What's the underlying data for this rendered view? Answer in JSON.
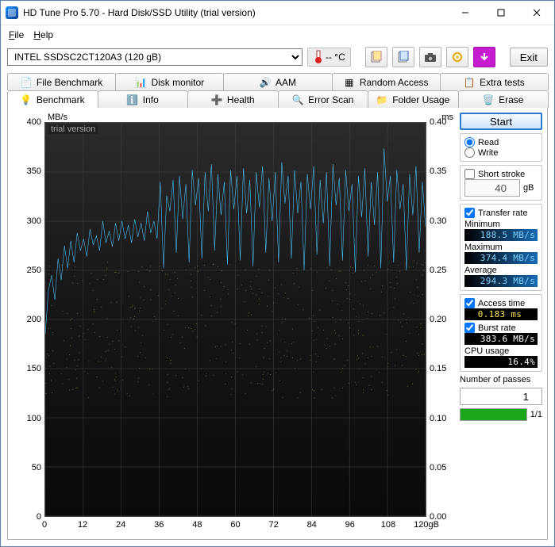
{
  "window": {
    "title": "HD Tune Pro 5.70 - Hard Disk/SSD Utility (trial version)"
  },
  "menu": {
    "file": "File",
    "help": "Help"
  },
  "drive": {
    "selected": "INTEL SSDSC2CT120A3 (120 gB)"
  },
  "temp": "-- °C",
  "exit": "Exit",
  "tabs": {
    "row1": [
      "File Benchmark",
      "Disk monitor",
      "AAM",
      "Random Access",
      "Extra tests"
    ],
    "row2": [
      "Benchmark",
      "Info",
      "Health",
      "Error Scan",
      "Folder Usage",
      "Erase"
    ],
    "active": "Benchmark"
  },
  "side": {
    "start": "Start",
    "read": "Read",
    "write": "Write",
    "short_stroke": "Short stroke",
    "short_stroke_val": "40",
    "short_stroke_unit": "gB",
    "transfer_rate": "Transfer rate",
    "minimum": "Minimum",
    "min_val": "188.5 MB/s",
    "maximum": "Maximum",
    "max_val": "374.4 MB/s",
    "average": "Average",
    "avg_val": "294.3 MB/s",
    "access_time": "Access time",
    "access_val": "0.183 ms",
    "burst_rate": "Burst rate",
    "burst_val": "383.6 MB/s",
    "cpu_usage": "CPU usage",
    "cpu_val": "16.4%",
    "passes": "Number of passes",
    "passes_val": "1",
    "progress_label": "1/1"
  },
  "chart_data": {
    "type": "line+scatter",
    "title": "",
    "watermark": "trial version",
    "x_unit": "gB",
    "y1_label": "MB/s",
    "y2_label": "ms",
    "y1_range": [
      0,
      400
    ],
    "y2_range": [
      0,
      0.4
    ],
    "x_range": [
      0,
      120
    ],
    "x_ticks": [
      0,
      12,
      24,
      36,
      48,
      60,
      72,
      84,
      96,
      108,
      120
    ],
    "y1_ticks": [
      0,
      50,
      100,
      150,
      200,
      250,
      300,
      350,
      400
    ],
    "y2_ticks": [
      0.0,
      0.05,
      0.1,
      0.15,
      0.2,
      0.25,
      0.3,
      0.35,
      0.4
    ],
    "transfer_series_mb_s": [
      185,
      230,
      245,
      220,
      262,
      240,
      275,
      252,
      280,
      258,
      288,
      270,
      282,
      264,
      292,
      276,
      285,
      270,
      300,
      278,
      290,
      274,
      298,
      280,
      300,
      282,
      296,
      278,
      302,
      284,
      298,
      280,
      310,
      288,
      300,
      282,
      340,
      252,
      326,
      310,
      342,
      268,
      346,
      302,
      338,
      258,
      352,
      316,
      344,
      262,
      350,
      310,
      358,
      270,
      348,
      306,
      340,
      256,
      352,
      312,
      346,
      260,
      354,
      308,
      342,
      254,
      350,
      314,
      356,
      268,
      344,
      300,
      350,
      258,
      360,
      318,
      346,
      262,
      352,
      308,
      340,
      250,
      348,
      312,
      356,
      266,
      342,
      298,
      350,
      254,
      358,
      316,
      344,
      260,
      352,
      310,
      338,
      248,
      346,
      304,
      354,
      264,
      340,
      296,
      350,
      252,
      374,
      320,
      346,
      258,
      352,
      312,
      338,
      250,
      348,
      306,
      356,
      268,
      340,
      294
    ],
    "access_scatter_ms": {
      "count": 520,
      "range_ms": [
        0.12,
        0.26
      ],
      "note": "dense band of access-time samples roughly between 0.12 and 0.26 ms across full x range"
    }
  }
}
